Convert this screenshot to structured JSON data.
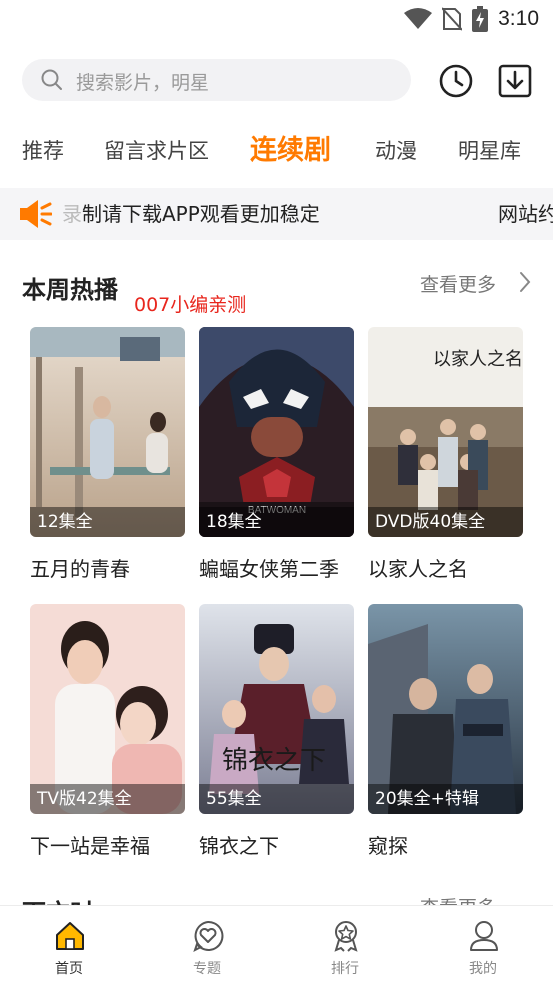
{
  "status": {
    "time": "3:10"
  },
  "search": {
    "placeholder": "搜索影片，明星"
  },
  "tabs": [
    {
      "label": "推荐",
      "active": false
    },
    {
      "label": "留言求片区",
      "active": false
    },
    {
      "label": "连续剧",
      "active": true
    },
    {
      "label": "动漫",
      "active": false
    },
    {
      "label": "明星库",
      "active": false
    }
  ],
  "notice": {
    "text": "制请下载APP观看更加稳定",
    "text_prefix": "录",
    "text_next": "网站约"
  },
  "section": {
    "title": "本周热播",
    "subtitle": "007小编亲测",
    "more": "查看更多"
  },
  "cards": [
    {
      "title": "五月的青春",
      "badge": "12集全"
    },
    {
      "title": "蝙蝠女侠第二季",
      "badge": "18集全"
    },
    {
      "title": "以家人之名",
      "badge": "DVD版40集全"
    },
    {
      "title": "下一站是幸福",
      "badge": "TV版42集全"
    },
    {
      "title": "锦衣之下",
      "badge": "55集全"
    },
    {
      "title": "窥探",
      "badge": "20集全+特辑"
    }
  ],
  "section2": {
    "title": "下方时",
    "more": "查看更多"
  },
  "nav": [
    {
      "label": "首页",
      "icon": "home-icon",
      "active": true
    },
    {
      "label": "专题",
      "icon": "heart-chat-icon",
      "active": false
    },
    {
      "label": "排行",
      "icon": "award-icon",
      "active": false
    },
    {
      "label": "我的",
      "icon": "user-icon",
      "active": false
    }
  ],
  "colors": {
    "accent": "#ff7a00",
    "red": "#e8261d"
  }
}
